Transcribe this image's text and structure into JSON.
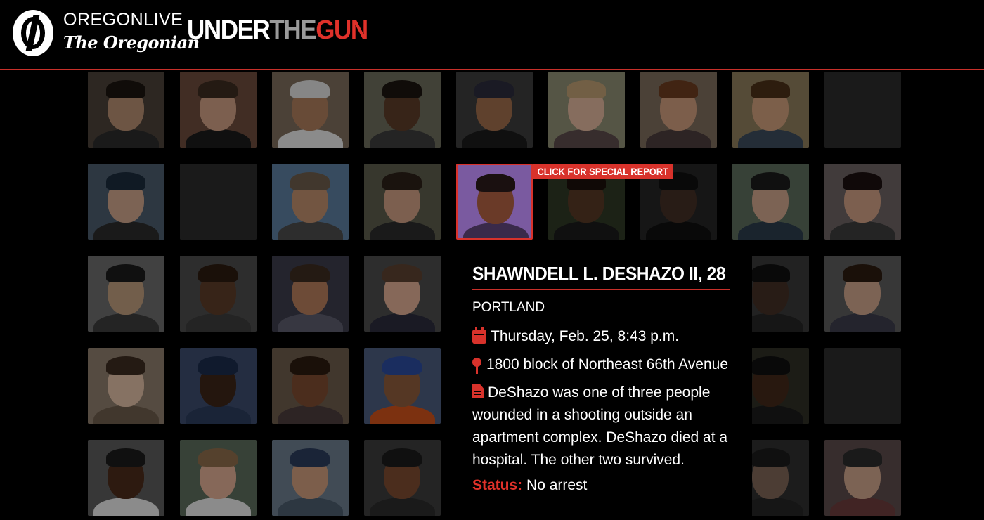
{
  "header": {
    "brand_top": "OREGONLIVE",
    "brand_bottom": "The Oregonian",
    "title_part1": "UNDER",
    "title_part2": "THE",
    "title_part3": "GUN"
  },
  "special_report_label": "CLICK FOR SPECIAL REPORT",
  "victim": {
    "name": "SHAWNDELL L. DESHAZO II, 28",
    "city": "PORTLAND",
    "date": "Thursday, Feb. 25, 8:43 p.m.",
    "location": "1800 block of Northeast 66th Avenue",
    "description": "DeShazo was one of three people wounded in a shooting outside an apartment complex. DeShazo died at a hospital. The other two survived.",
    "status_label": "Status:",
    "status_value": "No arrest"
  },
  "colors": {
    "accent": "#d8322b",
    "background": "#000000",
    "title_gray": "#9a9a9a"
  },
  "icons": [
    "calendar-icon",
    "map-pin-icon",
    "document-icon"
  ],
  "tiles": [
    {
      "row": 0,
      "col": 0,
      "skin": "#b08a6e",
      "bg": "#4a4038",
      "hair": "#1a1410",
      "shirt": "#2a2a2a"
    },
    {
      "row": 0,
      "col": 1,
      "skin": "#c89a80",
      "bg": "#6a4a3a",
      "hair": "#3a2a20",
      "shirt": "#1a1a1a"
    },
    {
      "row": 0,
      "col": 2,
      "skin": "#a87a5a",
      "bg": "#7a6a5a",
      "hair": "#d8d8d8",
      "shirt": "#e0e0e0"
    },
    {
      "row": 0,
      "col": 3,
      "skin": "#5a3a28",
      "bg": "#6a6a5a",
      "hair": "#1a1410",
      "shirt": "#3a3a3a"
    },
    {
      "row": 0,
      "col": 4,
      "skin": "#9a6a4a",
      "bg": "#3a3a3a",
      "hair": "#2a2a3a",
      "shirt": "#1a1a1a"
    },
    {
      "row": 0,
      "col": 5,
      "skin": "#d8b098",
      "bg": "#8a8a70",
      "hair": "#b89a70",
      "shirt": "#5a4a4a"
    },
    {
      "row": 0,
      "col": 6,
      "skin": "#c8987a",
      "bg": "#7a6a5a",
      "hair": "#6a3a20",
      "shirt": "#4a3a3a"
    },
    {
      "row": 0,
      "col": 7,
      "skin": "#c89a78",
      "bg": "#8a7a5a",
      "hair": "#4a3018",
      "shirt": "#3a4a5a"
    },
    {
      "row": 0,
      "col": 8,
      "empty": true
    },
    {
      "row": 1,
      "col": 0,
      "skin": "#c8a088",
      "bg": "#4a5a6a",
      "hair": "#1a2a3a",
      "shirt": "#2a2a2a"
    },
    {
      "row": 1,
      "col": 1,
      "empty": true
    },
    {
      "row": 1,
      "col": 2,
      "skin": "#b88a6a",
      "bg": "#5a7a9a",
      "hair": "#6a5a4a",
      "shirt": "#4a4a4a"
    },
    {
      "row": 1,
      "col": 3,
      "skin": "#c89a80",
      "bg": "#5a5a4a",
      "hair": "#2a2018",
      "shirt": "#2a2a2a"
    },
    {
      "row": 1,
      "col": 4,
      "featured": true,
      "skin": "#6a3a28",
      "bg": "#7a5aa0",
      "hair": "#1a1010",
      "shirt": "#3a2a4a"
    },
    {
      "row": 1,
      "col": 5,
      "skin": "#8a5a3a",
      "bg": "#4a5a3a",
      "hair": "#2a1a10",
      "shirt": "#2a2a2a",
      "dimmed": true
    },
    {
      "row": 1,
      "col": 6,
      "skin": "#6a4a3a",
      "bg": "#3a3a3a",
      "hair": "#1a1a1a",
      "shirt": "#1a1a1a",
      "dimmed": true
    },
    {
      "row": 1,
      "col": 7,
      "skin": "#c8a088",
      "bg": "#5a6a5a",
      "hair": "#1a1a1a",
      "shirt": "#2a3a4a"
    },
    {
      "row": 1,
      "col": 8,
      "skin": "#c89a80",
      "bg": "#6a6060",
      "hair": "#1a1010",
      "shirt": "#3a3a3a"
    },
    {
      "row": 2,
      "col": 0,
      "skin": "#b8987a",
      "bg": "#6a6a6a",
      "hair": "#1a1a1a",
      "shirt": "#3a3a3a"
    },
    {
      "row": 2,
      "col": 1,
      "skin": "#5a3a28",
      "bg": "#4a4a4a",
      "hair": "#2a1a10",
      "shirt": "#3a3a3a"
    },
    {
      "row": 2,
      "col": 2,
      "skin": "#b07a5a",
      "bg": "#3a3a4a",
      "hair": "#3a2a20",
      "shirt": "#5a5a6a"
    },
    {
      "row": 2,
      "col": 3,
      "skin": "#d8a890",
      "bg": "#4a4a4a",
      "hair": "#5a4030",
      "shirt": "#2a2a3a"
    },
    {
      "row": 2,
      "col": 7,
      "skin": "#6a4a3a",
      "bg": "#5a5a5a",
      "hair": "#1a1a1a",
      "shirt": "#3a3a3a",
      "dimmed": true
    },
    {
      "row": 2,
      "col": 8,
      "skin": "#c8a088",
      "bg": "#5a5a5a",
      "hair": "#2a1a10",
      "shirt": "#3a3a4a"
    },
    {
      "row": 3,
      "col": 0,
      "skin": "#d8b8a0",
      "bg": "#8a7a6a",
      "hair": "#3a2a20",
      "shirt": "#6a5a4a"
    },
    {
      "row": 3,
      "col": 1,
      "skin": "#3a2418",
      "bg": "#3a4a6a",
      "hair": "#1a2a4a",
      "shirt": "#2a3a5a"
    },
    {
      "row": 3,
      "col": 2,
      "skin": "#7a4a30",
      "bg": "#6a5a4a",
      "hair": "#2a1a10",
      "shirt": "#4a3a3a"
    },
    {
      "row": 3,
      "col": 3,
      "skin": "#8a5a3a",
      "bg": "#4a5a7a",
      "hair": "#2a4a9a",
      "shirt": "#c8501a"
    },
    {
      "row": 3,
      "col": 7,
      "skin": "#6a4028",
      "bg": "#4a4a3a",
      "hair": "#1a1a1a",
      "shirt": "#2a2a2a",
      "dimmed": true
    },
    {
      "row": 3,
      "col": 8,
      "empty": true
    },
    {
      "row": 4,
      "col": 0,
      "skin": "#4a2a1a",
      "bg": "#5a5a5a",
      "hair": "#1a1a1a",
      "shirt": "#e0e0e0"
    },
    {
      "row": 4,
      "col": 1,
      "skin": "#d8a890",
      "bg": "#5a6a5a",
      "hair": "#8a6a4a",
      "shirt": "#e0e0e0"
    },
    {
      "row": 4,
      "col": 2,
      "skin": "#c8987a",
      "bg": "#6a7a8a",
      "hair": "#2a3a5a",
      "shirt": "#4a5a6a"
    },
    {
      "row": 4,
      "col": 3,
      "skin": "#7a4a30",
      "bg": "#3a3a3a",
      "hair": "#1a1a1a",
      "shirt": "#2a2a2a"
    },
    {
      "row": 4,
      "col": 7,
      "skin": "#c8a088",
      "bg": "#4a4a4a",
      "hair": "#2a2a2a",
      "shirt": "#3a3a3a",
      "dimmed": true
    },
    {
      "row": 4,
      "col": 8,
      "skin": "#c8a088",
      "bg": "#5a4a4a",
      "hair": "#2a2a2a",
      "shirt": "#6a3a3a"
    }
  ]
}
